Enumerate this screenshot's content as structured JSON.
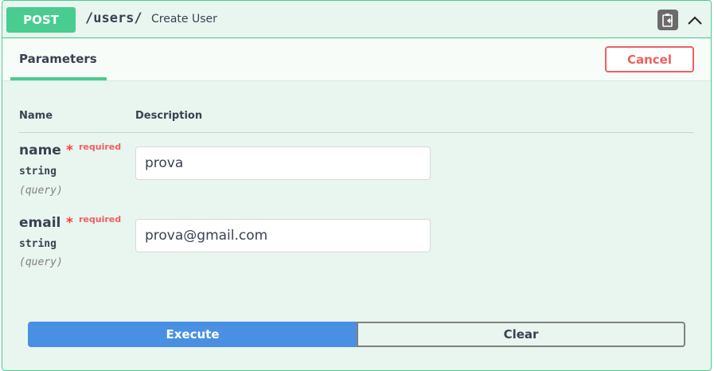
{
  "operation": {
    "method": "POST",
    "path": "/users/",
    "summary": "Create User",
    "copy_icon": "clipboard-icon",
    "collapse_icon": "chevron-up-icon"
  },
  "section": {
    "tab_label": "Parameters",
    "cancel_label": "Cancel"
  },
  "table": {
    "headers": [
      "Name",
      "Description"
    ]
  },
  "parameters": [
    {
      "name": "name",
      "required_mark": "*",
      "required_label": "required",
      "type": "string",
      "in": "(query)",
      "value": "prova"
    },
    {
      "name": "email",
      "required_mark": "*",
      "required_label": "required",
      "type": "string",
      "in": "(query)",
      "value": "prova@gmail.com"
    }
  ],
  "actions": {
    "execute_label": "Execute",
    "clear_label": "Clear"
  },
  "colors": {
    "post_green": "#49cc90",
    "execute_blue": "#4990e2",
    "cancel_red": "#f06060"
  }
}
